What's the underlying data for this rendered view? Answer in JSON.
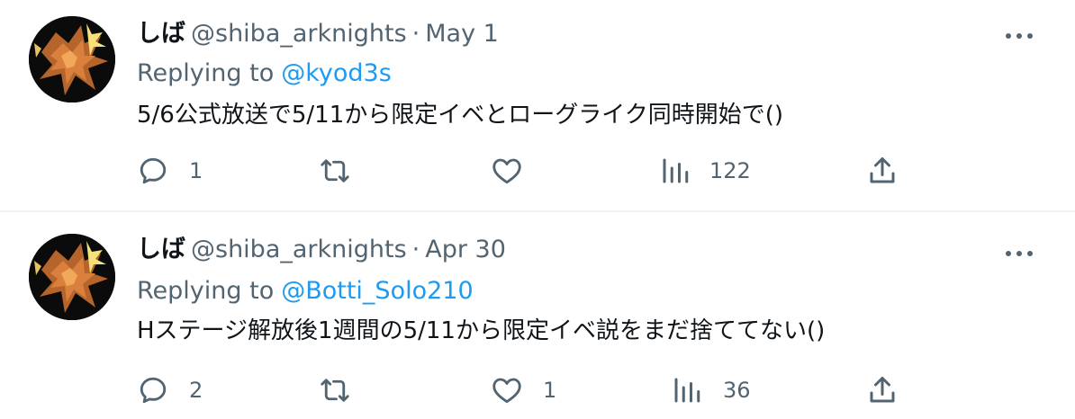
{
  "tweets": [
    {
      "name": "しば",
      "handle": "@shiba_arknights",
      "separator": "·",
      "date": "May 1",
      "replying_to_label": "Replying to",
      "replying_to_handle": "@kyod3s",
      "text": "5/6公式放送で5/11から限定イベとローグライク同時開始で()",
      "reply_count": "1",
      "retweet_count": "",
      "like_count": "",
      "view_count": "122"
    },
    {
      "name": "しば",
      "handle": "@shiba_arknights",
      "separator": "·",
      "date": "Apr 30",
      "replying_to_label": "Replying to",
      "replying_to_handle": "@Botti_Solo210",
      "text": "Hステージ解放後1週間の5/11から限定イベ説をまだ捨ててない()",
      "reply_count": "2",
      "retweet_count": "",
      "like_count": "1",
      "view_count": "36"
    }
  ],
  "icons": {
    "more": "more-horizontal-icon",
    "reply": "reply-bubble-icon",
    "retweet": "retweet-icon",
    "like": "heart-icon",
    "views": "views-bar-chart-icon",
    "share": "share-upload-icon"
  },
  "colors": {
    "text_primary": "#0f1419",
    "text_secondary": "#536471",
    "link": "#1d9bf0",
    "divider": "#eff3f4"
  }
}
